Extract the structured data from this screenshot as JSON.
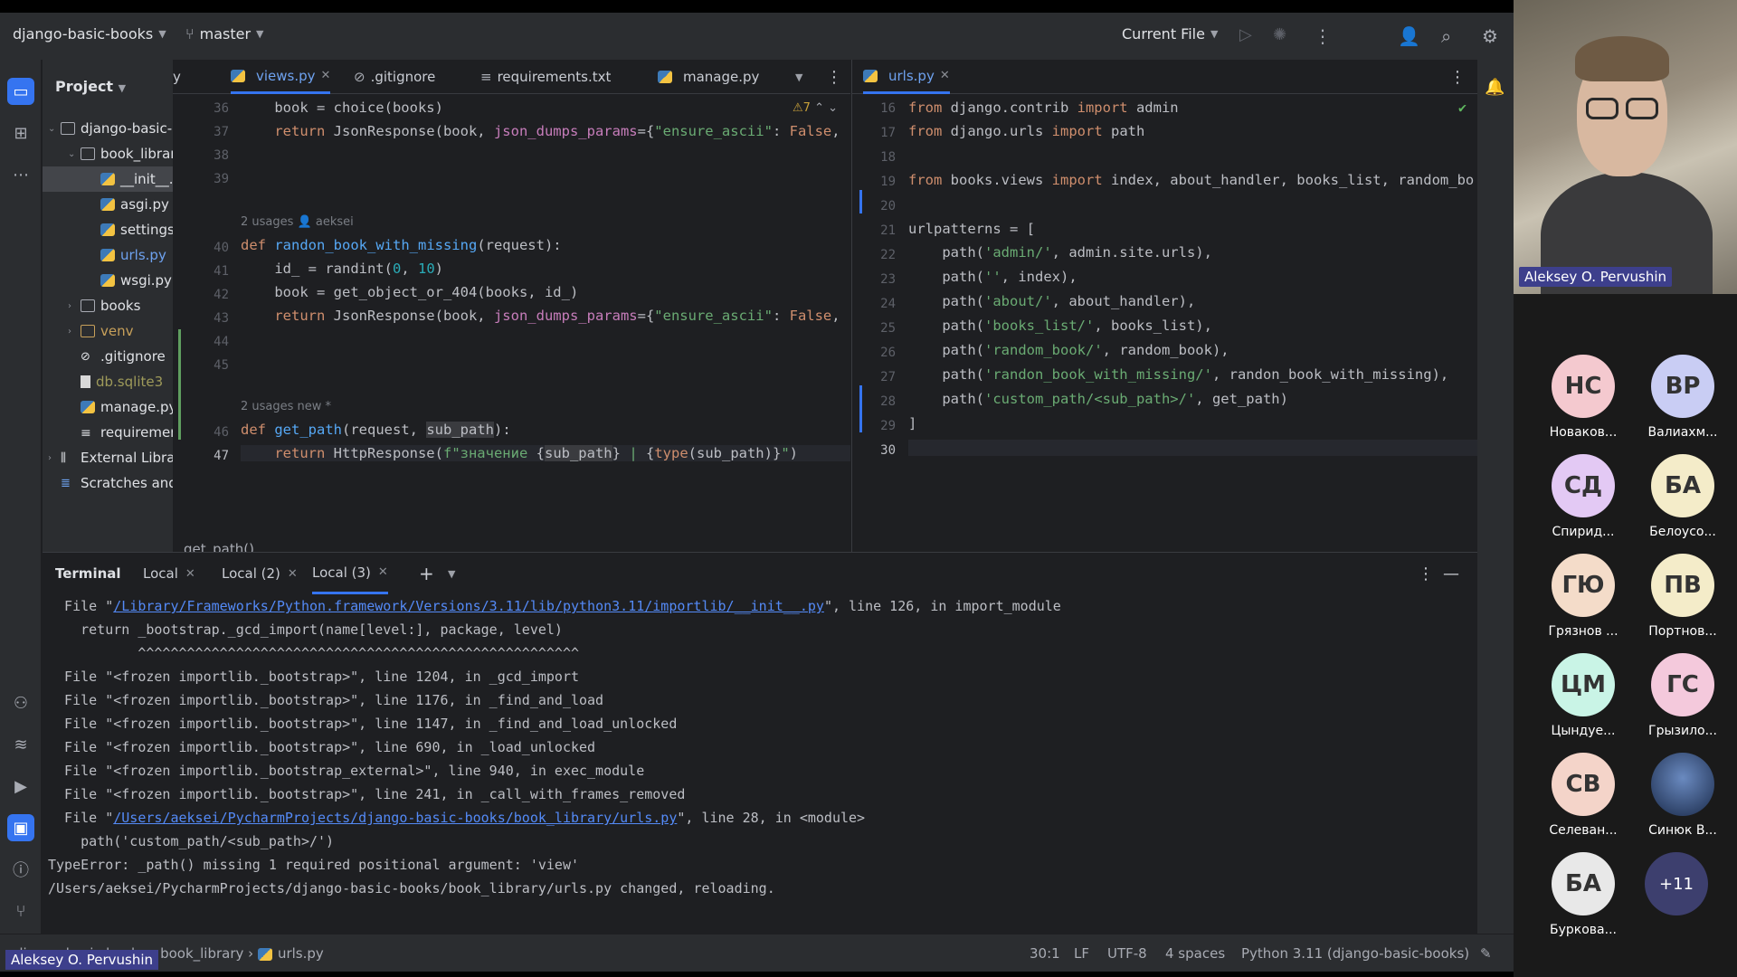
{
  "topbar": {
    "project": "django-basic-books",
    "branch": "master",
    "run_config": "Current File"
  },
  "project_panel": {
    "title": "Project",
    "items": [
      {
        "label": "django-basic-",
        "kind": "folder",
        "depth": 0,
        "expanded": true
      },
      {
        "label": "book_librar",
        "kind": "folder",
        "depth": 1,
        "expanded": true
      },
      {
        "label": "__init__.p",
        "kind": "py",
        "depth": 2,
        "selected": true
      },
      {
        "label": "asgi.py",
        "kind": "py",
        "depth": 2
      },
      {
        "label": "settings",
        "kind": "py",
        "depth": 2
      },
      {
        "label": "urls.py",
        "kind": "py",
        "depth": 2,
        "highlight": true
      },
      {
        "label": "wsgi.py",
        "kind": "py",
        "depth": 2
      },
      {
        "label": "books",
        "kind": "folder",
        "depth": 1
      },
      {
        "label": "venv",
        "kind": "folder",
        "depth": 1,
        "color": "#c7a05a"
      },
      {
        "label": ".gitignore",
        "kind": "ignore",
        "depth": 1
      },
      {
        "label": "db.sqlite3",
        "kind": "file",
        "depth": 1,
        "color": "#9e9a5a"
      },
      {
        "label": "manage.py",
        "kind": "py",
        "depth": 1
      },
      {
        "label": "requiremer",
        "kind": "text",
        "depth": 1
      },
      {
        "label": "External Librar",
        "kind": "lib",
        "depth": 0
      },
      {
        "label": "Scratches and",
        "kind": "scratch",
        "depth": 0
      }
    ]
  },
  "editor_left": {
    "tabs": [
      {
        "label": "y",
        "active": false
      },
      {
        "label": "views.py",
        "active": true
      },
      {
        "label": ".gitignore",
        "active": false
      },
      {
        "label": "requirements.txt",
        "active": false
      },
      {
        "label": "manage.py",
        "active": false
      }
    ],
    "warnings": "⚠7",
    "line_numbers": [
      "36",
      "37",
      "38",
      "39",
      "40",
      "41",
      "42",
      "43",
      "44",
      "45",
      "46",
      "47"
    ],
    "hints": {
      "usages_1": "2 usages",
      "author_1": "aeksei",
      "usages_2": "2 usages",
      "author_2": "new *"
    },
    "breadcrumb": "get_path()"
  },
  "editor_right": {
    "tab": "urls.py",
    "line_numbers": [
      "16",
      "17",
      "18",
      "19",
      "20",
      "21",
      "22",
      "23",
      "24",
      "25",
      "26",
      "27",
      "28",
      "29",
      "30"
    ]
  },
  "terminal": {
    "title": "Terminal",
    "tabs": [
      "Local",
      "Local (2)",
      "Local (3)"
    ],
    "lines": {
      "l1_pre": "  File \"",
      "l1_link": "/Library/Frameworks/Python.framework/Versions/3.11/lib/python3.11/importlib/__init__.py",
      "l1_post": "\", line 126, in import_module",
      "l2": "    return _bootstrap._gcd_import(name[level:], package, level)",
      "l3": "           ^^^^^^^^^^^^^^^^^^^^^^^^^^^^^^^^^^^^^^^^^^^^^^^^^^^^^^",
      "l4": "  File \"<frozen importlib._bootstrap>\", line 1204, in _gcd_import",
      "l5": "  File \"<frozen importlib._bootstrap>\", line 1176, in _find_and_load",
      "l6": "  File \"<frozen importlib._bootstrap>\", line 1147, in _find_and_load_unlocked",
      "l7": "  File \"<frozen importlib._bootstrap>\", line 690, in _load_unlocked",
      "l8": "  File \"<frozen importlib._bootstrap_external>\", line 940, in exec_module",
      "l9": "  File \"<frozen importlib._bootstrap>\", line 241, in _call_with_frames_removed",
      "l10_pre": "  File \"",
      "l10_link": "/Users/aeksei/PycharmProjects/django-basic-books/book_library/urls.py",
      "l10_post": "\", line 28, in <module>",
      "l11": "    path('custom_path/<sub_path>/')",
      "l12": "TypeError: _path() missing 1 required positional argument: 'view'",
      "l13": "/Users/aeksei/PycharmProjects/django-basic-books/book_library/urls.py changed, reloading."
    }
  },
  "status": {
    "crumb_project": "django-basic-books",
    "crumb_folder": "book_library",
    "crumb_file": "urls.py",
    "position": "30:1",
    "line_sep": "LF",
    "encoding": "UTF-8",
    "indent": "4 spaces",
    "interpreter": "Python 3.11 (django-basic-books)"
  },
  "video": {
    "speaker": "Aleksey O. Pervushin",
    "bottom_name": "Aleksey O. Pervushin",
    "more": "+11",
    "participants": [
      {
        "initials": "НС",
        "name": "Новаков...",
        "color": "#f4c9cf"
      },
      {
        "initials": "ВР",
        "name": "Валиахм...",
        "color": "#c9cdf4"
      },
      {
        "initials": "СД",
        "name": "Спирид...",
        "color": "#e3c9f4"
      },
      {
        "initials": "БА",
        "name": "Белоусо...",
        "color": "#f4ecc9"
      },
      {
        "initials": "ГЮ",
        "name": "Грязнов ...",
        "color": "#f4dcc9"
      },
      {
        "initials": "ПВ",
        "name": "Портнов...",
        "color": "#f4ecc9"
      },
      {
        "initials": "ЦМ",
        "name": "Цындуе...",
        "color": "#c9f4e6"
      },
      {
        "initials": "ГС",
        "name": "Грызило...",
        "color": "#f4c9dc"
      },
      {
        "initials": "СВ",
        "name": "Селеван...",
        "color": "#f4d4c9"
      },
      {
        "initials": "",
        "name": "Синюк В...",
        "color": "#2a3a5a"
      },
      {
        "initials": "БА",
        "name": "Буркова...",
        "color": "#e8e8e8"
      }
    ]
  }
}
